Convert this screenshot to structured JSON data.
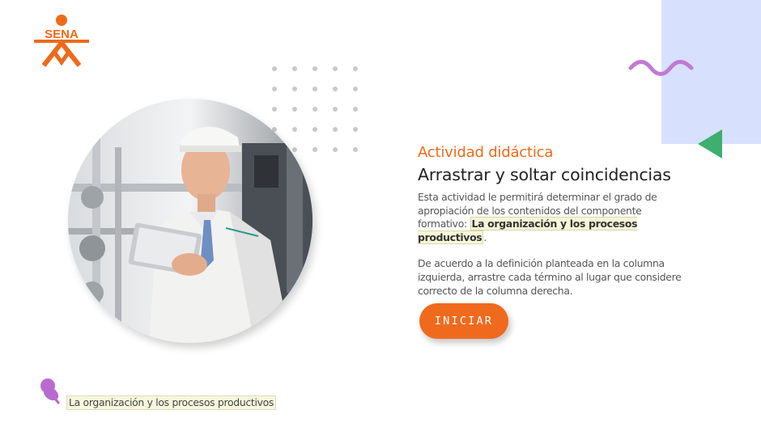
{
  "logo": {
    "text": "SENA",
    "icon": "sena-logo-icon",
    "color": "#ee6a1a"
  },
  "activity": {
    "kicker": "Actividad didáctica",
    "title": "Arrastrar y soltar coincidencias",
    "intro": "Esta actividad le permitirá determinar el grado de apropiación de los contenidos del componente formativo:",
    "component": "La organización y los procesos productivos",
    "period": ".",
    "instructions": "De acuerdo a la definición planteada en la columna izquierda, arrastre cada término al lugar que considere correcto de la columna derecha."
  },
  "start_button": {
    "label": "INICIAR",
    "color": "#f06a1e"
  },
  "footer": {
    "label": "La organización y los procesos productivos",
    "icon": "pushpin-icon"
  },
  "colors": {
    "accent": "#ee6a1a",
    "panel": "#d7e1fd",
    "wave": "#c17ad3",
    "triangle": "#3daf6e",
    "pin": "#b96ad0"
  }
}
